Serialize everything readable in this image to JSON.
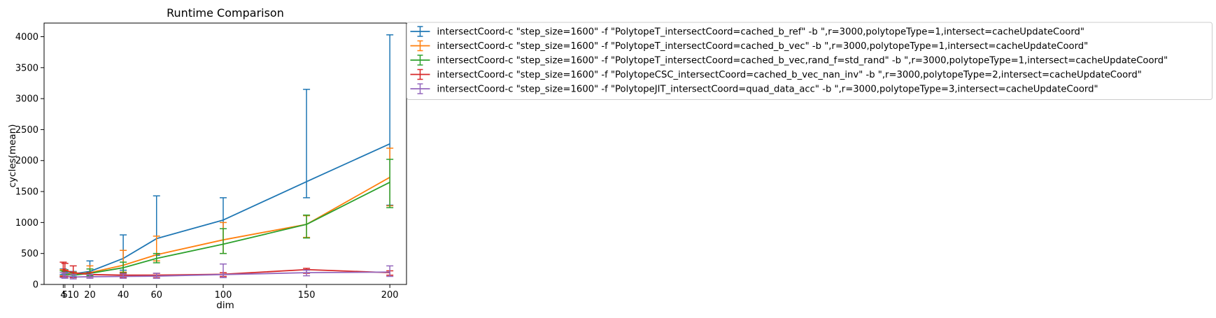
{
  "chart_data": {
    "type": "line",
    "title": "Runtime Comparison",
    "xlabel": "dim",
    "ylabel": "cycles(mean)",
    "xlim": [
      -7.5,
      210
    ],
    "ylim": [
      0,
      4220
    ],
    "x": [
      4,
      5,
      10,
      20,
      40,
      60,
      100,
      150,
      200
    ],
    "xticks": [
      4,
      5,
      10,
      20,
      40,
      60,
      100,
      150,
      200
    ],
    "xtick_labels": [
      "4",
      "5",
      "10",
      "20",
      "40",
      "60",
      "100",
      "150",
      "200"
    ],
    "yticks": [
      0,
      500,
      1000,
      1500,
      2000,
      2500,
      3000,
      3500,
      4000
    ],
    "ytick_labels": [
      "0",
      "500",
      "1000",
      "1500",
      "2000",
      "2500",
      "3000",
      "3500",
      "4000"
    ],
    "grid": false,
    "legend_position": "outside-upper-right",
    "series": [
      {
        "name": "intersectCoord-c \"step_size=1600\" -f \"PolytopeT_intersectCoord=cached_b_ref\" -b \",r=3000,polytopeType=1,intersect=cacheUpdateCoord\"",
        "color": "#1f77b4",
        "values": [
          205,
          200,
          170,
          210,
          420,
          740,
          1040,
          1660,
          2270
        ],
        "err_low": [
          160,
          160,
          130,
          150,
          230,
          470,
          900,
          1400,
          1280
        ],
        "err_high": [
          250,
          240,
          210,
          380,
          800,
          1430,
          1400,
          3150,
          4030
        ]
      },
      {
        "name": "intersectCoord-c \"step_size=1600\" -f \"PolytopeT_intersectCoord=cached_b_vec\" -b \",r=3000,polytopeType=1,intersect=cacheUpdateCoord\"",
        "color": "#ff7f0e",
        "values": [
          190,
          185,
          160,
          190,
          310,
          480,
          720,
          970,
          1730
        ],
        "err_low": [
          140,
          140,
          120,
          140,
          200,
          380,
          500,
          760,
          1270
        ],
        "err_high": [
          240,
          230,
          200,
          300,
          550,
          780,
          1000,
          1110,
          2200
        ]
      },
      {
        "name": "intersectCoord-c \"step_size=1600\" -f \"PolytopeT_intersectCoord=cached_b_vec,rand_f=std_rand\" -b \",r=3000,polytopeType=1,intersect=cacheUpdateCoord\"",
        "color": "#2ca02c",
        "values": [
          175,
          170,
          150,
          180,
          270,
          420,
          650,
          970,
          1650
        ],
        "err_low": [
          130,
          130,
          110,
          140,
          190,
          350,
          500,
          750,
          1240
        ],
        "err_high": [
          220,
          210,
          190,
          250,
          360,
          500,
          900,
          1120,
          2020
        ]
      },
      {
        "name": "intersectCoord-c \"step_size=1600\" -f \"PolytopeCSC_intersectCoord=cached_b_vec_nan_inv\" -b \",r=3000,polytopeType=2,intersect=cacheUpdateCoord\"",
        "color": "#d62728",
        "values": [
          250,
          230,
          190,
          160,
          150,
          150,
          165,
          240,
          190
        ],
        "err_low": [
          130,
          120,
          110,
          120,
          110,
          110,
          130,
          180,
          150
        ],
        "err_high": [
          360,
          340,
          300,
          190,
          180,
          180,
          190,
          260,
          220
        ]
      },
      {
        "name": "intersectCoord-c \"step_size=1600\" -f \"PolytopeJIT_intersectCoord=quad_data_acc\" -b \",r=3000,polytopeType=3,intersect=cacheUpdateCoord\"",
        "color": "#9467bd",
        "values": [
          150,
          140,
          120,
          125,
          130,
          135,
          160,
          190,
          200
        ],
        "err_low": [
          110,
          100,
          90,
          100,
          100,
          100,
          110,
          140,
          130
        ],
        "err_high": [
          190,
          180,
          160,
          160,
          170,
          180,
          330,
          230,
          300
        ]
      }
    ]
  }
}
